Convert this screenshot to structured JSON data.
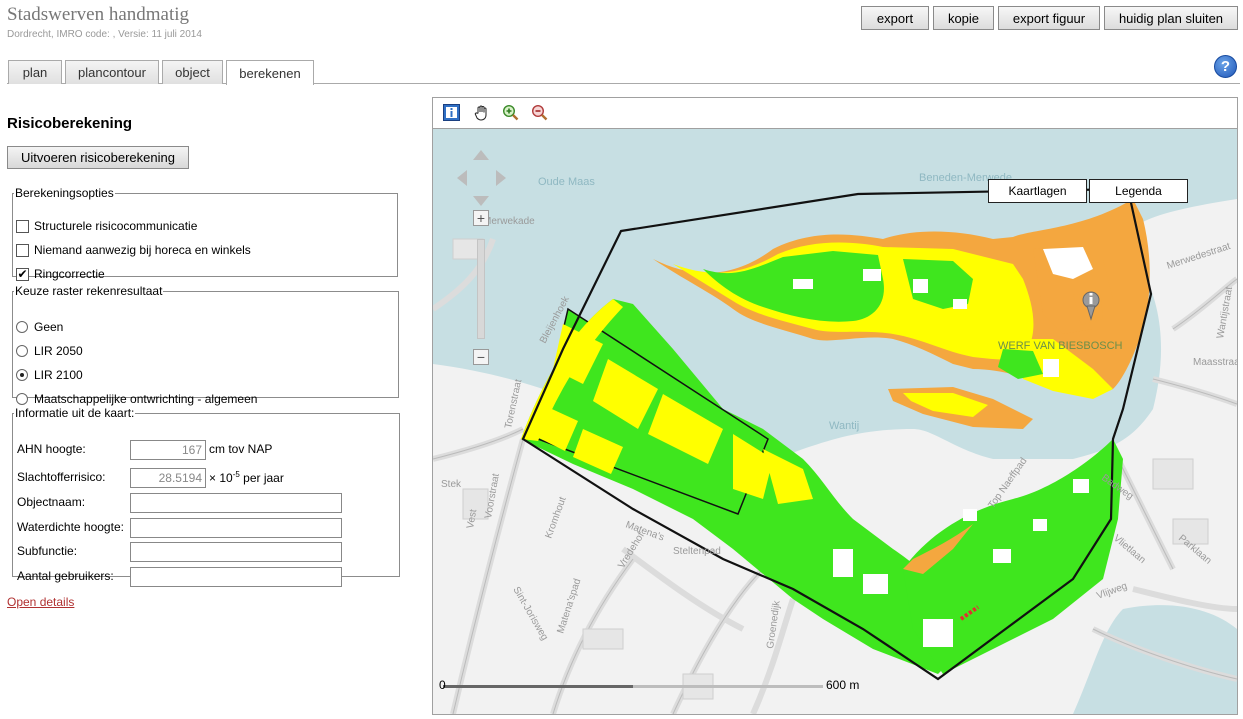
{
  "header": {
    "title": "Stadswerven handmatig",
    "subtitle": "Dordrecht, IMRO code: , Versie: 11 juli 2014",
    "buttons": {
      "export": "export",
      "kopie": "kopie",
      "export_figuur": "export figuur",
      "close_plan": "huidig plan sluiten"
    },
    "help": "?"
  },
  "tabs": [
    {
      "label": "plan",
      "active": false
    },
    {
      "label": "plancontour",
      "active": false
    },
    {
      "label": "object",
      "active": false
    },
    {
      "label": "berekenen",
      "active": true
    }
  ],
  "left": {
    "section_title": "Risicoberekening",
    "run_button": "Uitvoeren risicoberekening",
    "options": {
      "legend": "Berekeningsopties",
      "items": [
        {
          "label": "Structurele risicocommunicatie",
          "checked": false
        },
        {
          "label": "Niemand aanwezig bij horeca en winkels",
          "checked": false
        },
        {
          "label": "Ringcorrectie",
          "checked": true
        }
      ]
    },
    "raster": {
      "legend": "Keuze raster rekenresultaat",
      "items": [
        {
          "label": "Geen",
          "selected": false
        },
        {
          "label": "LIR 2050",
          "selected": false
        },
        {
          "label": "LIR 2100",
          "selected": true
        },
        {
          "label": "Maatschappelijke ontwrichting - algemeen",
          "selected": false
        }
      ]
    },
    "info": {
      "legend": "Informatie uit de kaart:",
      "ahn_label": "AHN hoogte:",
      "ahn_value": "167",
      "ahn_unit": "cm tov NAP",
      "slachtoffer_label": "Slachtofferrisico:",
      "slachtoffer_value": "28.5194",
      "slachtoffer_unit_prefix": "× 10",
      "slachtoffer_unit_exp": "-5",
      "slachtoffer_unit_suffix": " per jaar",
      "objectnaam_label": "Objectnaam:",
      "objectnaam_value": "",
      "waterdicht_label": "Waterdichte hoogte:",
      "waterdicht_value": "",
      "subfunctie_label": "Subfunctie:",
      "subfunctie_value": "",
      "gebruikers_label": "Aantal gebruikers:",
      "gebruikers_value": ""
    },
    "open_details": "Open details"
  },
  "map": {
    "tools": [
      "info-icon",
      "pan-hand-icon",
      "zoom-in-icon",
      "zoom-out-icon"
    ],
    "buttons": {
      "layers": "Kaartlagen",
      "legend": "Legenda"
    },
    "zoom_in": "+",
    "zoom_out": "−",
    "scale": {
      "start": "0",
      "end": "600 m"
    },
    "labels": {
      "oude_maas": "Oude Maas",
      "beneden_merwede": "Beneden-Merwede",
      "merwekade": "Merwekade",
      "bleijenhoek": "Bleijenhoek",
      "torenstraat": "Torenstraat",
      "voorstraat": "Voorstraat",
      "vest": "Vest",
      "stek": "Stek",
      "kromhout": "Kromhout",
      "matenaweg": "Matena's",
      "vredenhof": "Vredehof",
      "stelten": "Steltenpad",
      "jorisweg": "Sint-Jorisweg",
      "wantij": "Wantij",
      "werf": "WERF VAN BIESBOSCH",
      "merwedestraat": "Merwedestraat",
      "maasstraat": "Maasstraat",
      "wantijstraat": "Wantijstraat",
      "badweg": "Badweg",
      "parklaan": "Parklaan",
      "vlijweg": "Vlijweg",
      "vlietlaan": "Vlietlaan",
      "topnaeffpad": "Top Naeffpad",
      "groenedijk": "Groenedijk",
      "matenapad": "Matena'spad"
    },
    "colors": {
      "water": "#c7dfe3",
      "land": "#f2f2f2",
      "green": "#3fe61e",
      "yellow": "#ffff00",
      "orange": "#f4a73f",
      "outline": "#111111"
    }
  }
}
